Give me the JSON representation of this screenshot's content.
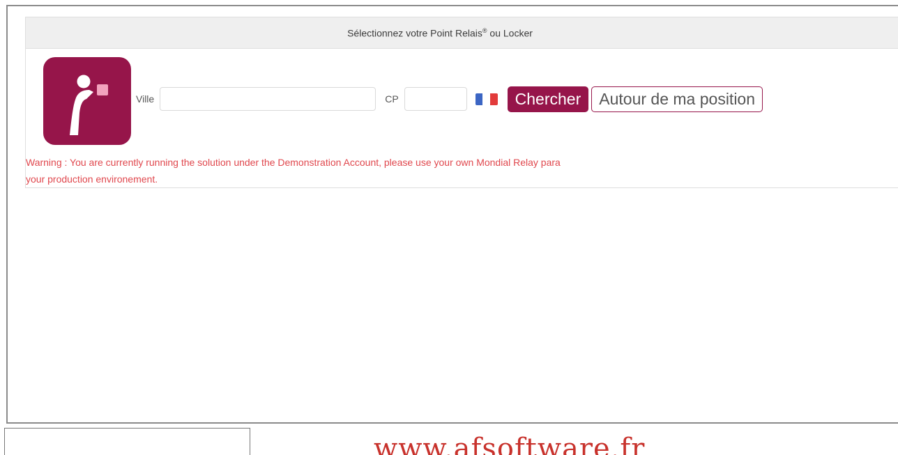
{
  "widget": {
    "header_prefix": "Sélectionnez votre Point Relais",
    "header_sup": "®",
    "header_suffix": " ou Locker",
    "search": {
      "ville_label": "Ville",
      "ville_value": "",
      "cp_label": "CP",
      "cp_value": "",
      "search_button": "Chercher",
      "position_button": "Autour de ma position"
    },
    "warning_line1": "Warning : You are currently running the solution under the Demonstration Account, please use your own Mondial Relay para",
    "warning_line2": "your production environement."
  },
  "colors": {
    "brand": "#96154a",
    "warning": "#e0474d",
    "flag_blue": "#3c66c4",
    "flag_white": "#ffffff",
    "flag_red": "#e23b3b"
  },
  "icons": {
    "logo": "mondial-relay-logo-icon",
    "flag": "france-flag-icon"
  },
  "footer": {
    "input_value": "",
    "site_url": "www.afsoftware.fr"
  }
}
